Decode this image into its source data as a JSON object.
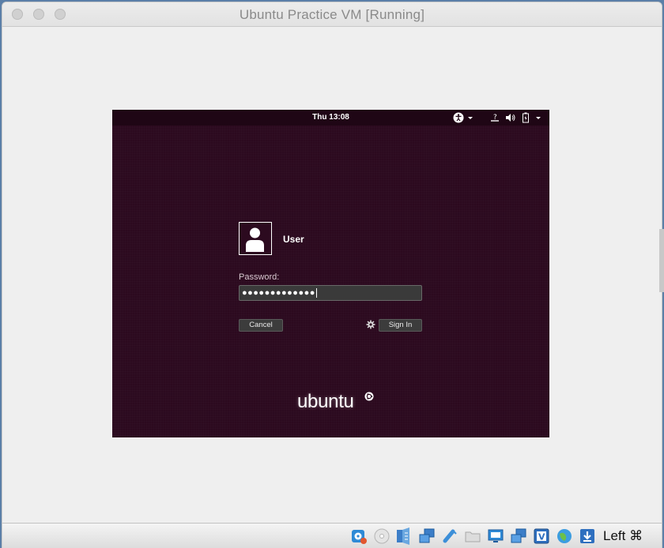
{
  "window": {
    "title": "Ubuntu Practice VM [Running]",
    "traffic_lights": [
      "close",
      "minimize",
      "zoom"
    ]
  },
  "vm": {
    "topbar": {
      "clock": "Thu 13:08",
      "icons": [
        "accessibility-icon",
        "dropdown-arrow-icon",
        "network-unknown-icon",
        "volume-icon",
        "battery-icon",
        "system-menu-arrow-icon"
      ]
    },
    "login": {
      "username": "User",
      "password_label": "Password:",
      "password_value": "●●●●●●●●●●●●●",
      "cancel_label": "Cancel",
      "signin_label": "Sign In"
    },
    "branding": {
      "logo_text": "ubuntu"
    },
    "colors": {
      "background": "#2c0a1f",
      "topbar": "#1f0615"
    }
  },
  "statusbar": {
    "icons": [
      "hard-disk-icon",
      "optical-drive-icon",
      "audio-icon",
      "network-icon",
      "usb-icon",
      "shared-folder-icon",
      "display-icon",
      "capture-icon",
      "virtualbox-icon",
      "globe-icon",
      "download-icon"
    ],
    "host_key": "Left ⌘"
  }
}
